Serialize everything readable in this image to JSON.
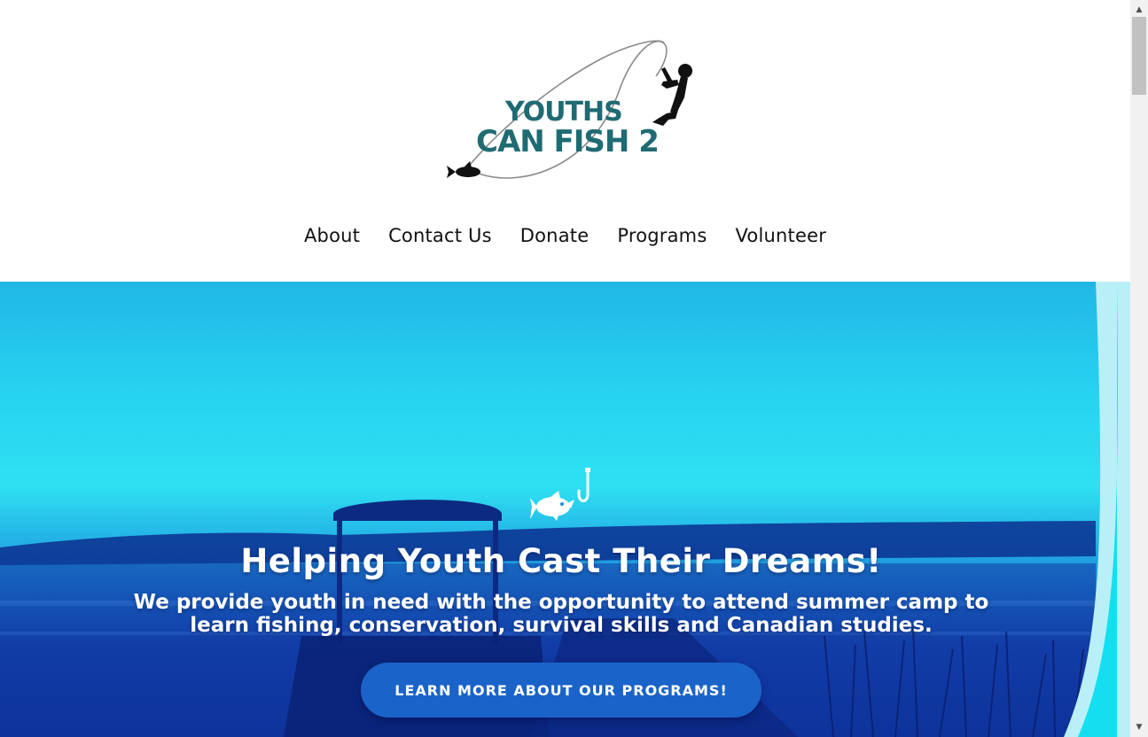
{
  "header": {
    "logo": {
      "line1": "YOUTHS",
      "line2": "CAN FISH 2",
      "icon": "fisherman-fish-logo"
    }
  },
  "nav": {
    "items": [
      {
        "label": "About"
      },
      {
        "label": "Contact Us"
      },
      {
        "label": "Donate"
      },
      {
        "label": "Programs"
      },
      {
        "label": "Volunteer"
      }
    ]
  },
  "hero": {
    "icon": "fish-hook-icon",
    "title": "Helping Youth Cast Their Dreams!",
    "subtitle": "We provide youth in need with the opportunity to attend summer camp to learn fishing, conservation, survival skills and Canadian studies.",
    "button_label": "LEARN MORE ABOUT OUR PROGRAMS!",
    "colors": {
      "accent": "#1a64c9",
      "sky": "#2fe0f2",
      "water": "#0a2b8f",
      "wave": "#14dff0"
    }
  },
  "scrollbar": {
    "up_icon": "triangle-up-icon",
    "down_icon": "triangle-down-icon"
  }
}
